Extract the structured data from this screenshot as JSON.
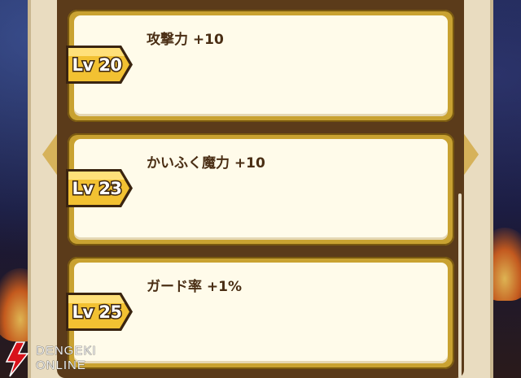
{
  "skills": [
    {
      "level": "Lv 20",
      "effect": "攻撃力 +10"
    },
    {
      "level": "Lv 23",
      "effect": "かいふく魔力 +10"
    },
    {
      "level": "Lv 25",
      "effect": "ガード率 +1%"
    }
  ],
  "watermark": {
    "line1": "DENGEKI",
    "line2": "ONLINE"
  },
  "colors": {
    "badge_gold": "#f2c132",
    "card_face": "#fffbea",
    "frame_brown": "#5b3b1a",
    "text_brown": "#4a2e14"
  },
  "icons": {
    "prev": "left-arrow-icon",
    "next": "right-arrow-icon",
    "watermark_logo": "dengeki-logo-icon"
  }
}
